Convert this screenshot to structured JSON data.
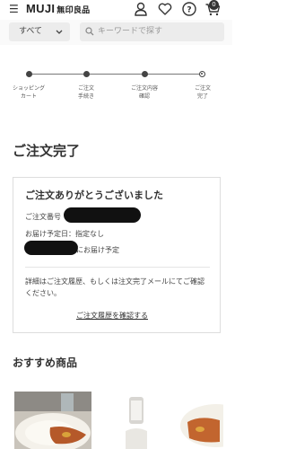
{
  "header": {
    "logo_main": "MUJI",
    "logo_sub": "無印良品",
    "cart_count": "0",
    "icons": [
      "menu-icon",
      "user-icon",
      "heart-icon",
      "help-icon",
      "cart-icon"
    ]
  },
  "search": {
    "category": "すべて",
    "placeholder": "キーワードで探す"
  },
  "steps": [
    {
      "label": "ショッピング\nカート"
    },
    {
      "label": "ご注文\n手続き"
    },
    {
      "label": "ご注文内容\n確認"
    },
    {
      "label": "ご注文\n完了"
    }
  ],
  "page": {
    "title": "ご注文完了"
  },
  "confirmation": {
    "thanks": "ご注文ありがとうございました",
    "order_number_label": "ご注文番号",
    "delivery_date": "お届け予定日：指定なし",
    "delivery_note": "にお届け予定",
    "detail": "詳細はご注文履歴、もしくは注文完了メールにてご確認ください。",
    "history_link": "ご注文履歴を確認する"
  },
  "recommend": {
    "title": "おすすめ商品"
  },
  "colors": {
    "text": "#333333",
    "search_bg": "#ececec",
    "accent_dark": "#111111"
  }
}
